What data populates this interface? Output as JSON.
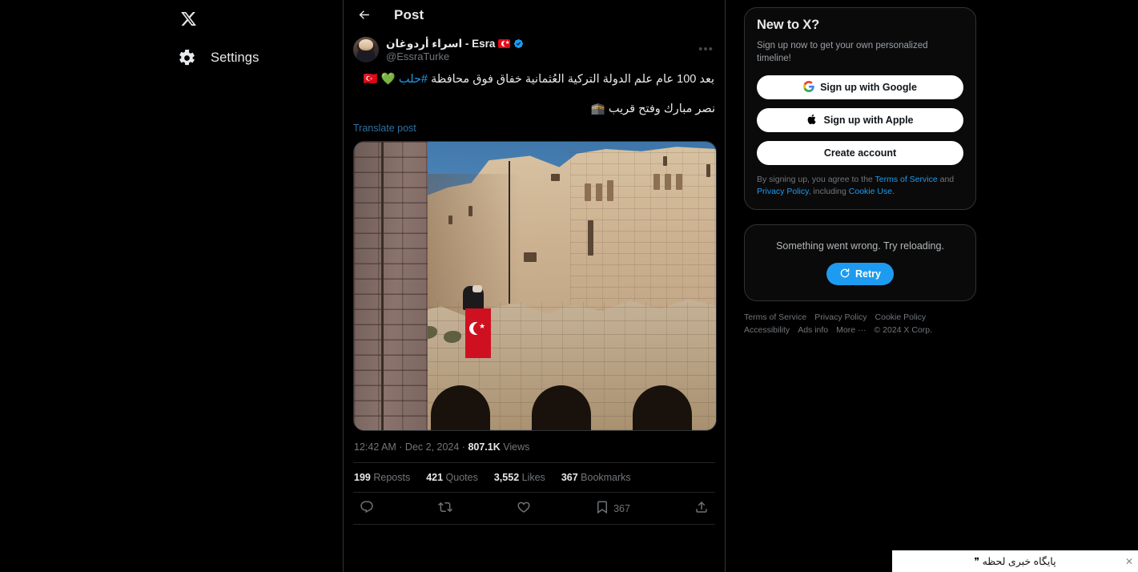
{
  "nav": {
    "logo_icon": "x-logo-icon",
    "items": [
      {
        "label": "Settings",
        "icon": "gear-icon"
      }
    ]
  },
  "post_header": {
    "back_icon": "arrow-left-icon",
    "title": "Post"
  },
  "post": {
    "author": {
      "display_name": "اسراء أردوغان - Esra",
      "flag_emoji": "turkey-flag",
      "verified_icon": "verified-badge-icon",
      "handle": "@EssraTurke",
      "avatar_name": "author-avatar"
    },
    "more_icon": "more-options-icon",
    "more_label": "•••",
    "text_line1_prefix": "بعد 100 عام علم الدولة التركية العُثمانية خفاق فوق محافظة ",
    "text_hashtag": "#حلب",
    "text_line1_suffix": " 💚 🇹🇷",
    "text_line2": "نصر مبارك وفتح قريب 🕋",
    "translate_label": "Translate post",
    "image_alt": "Citadel of Aleppo with Turkish flag",
    "timestamp": "12:42 AM · Dec 2, 2024 · ",
    "views_count": "807.1K",
    "views_label": " Views",
    "stats": [
      {
        "count": "199",
        "label": "Reposts"
      },
      {
        "count": "421",
        "label": "Quotes"
      },
      {
        "count": "3,552",
        "label": "Likes"
      },
      {
        "count": "367",
        "label": "Bookmarks"
      }
    ],
    "actions": [
      {
        "icon": "reply-icon",
        "count": ""
      },
      {
        "icon": "repost-icon",
        "count": ""
      },
      {
        "icon": "like-icon",
        "count": ""
      },
      {
        "icon": "bookmark-icon",
        "count": "367"
      },
      {
        "icon": "share-icon",
        "count": ""
      }
    ]
  },
  "signup_card": {
    "title": "New to X?",
    "subtitle": "Sign up now to get your own personalized timeline!",
    "google_label": "Sign up with Google",
    "apple_label": "Sign up with Apple",
    "create_label": "Create account",
    "legal_prefix": "By signing up, you agree to the ",
    "terms": "Terms of Service",
    "legal_and": " and ",
    "privacy": "Privacy Policy",
    "legal_including": ", including ",
    "cookie": "Cookie Use",
    "legal_end": "."
  },
  "error_card": {
    "message": "Something went wrong. Try reloading.",
    "retry_label": "Retry",
    "retry_icon": "refresh-icon"
  },
  "footer": {
    "links": [
      "Terms of Service",
      "Privacy Policy",
      "Cookie Policy",
      "Accessibility",
      "Ads info",
      "More ···"
    ],
    "copyright": "© 2024 X Corp."
  },
  "banner": {
    "text": "پایگاه خبری لحظه ❞",
    "close_label": "✕"
  },
  "colors": {
    "accent": "#1d9bf0",
    "background": "#000000",
    "border": "#2f3336",
    "muted_text": "#71767b",
    "primary_text": "#e7e9ea"
  }
}
